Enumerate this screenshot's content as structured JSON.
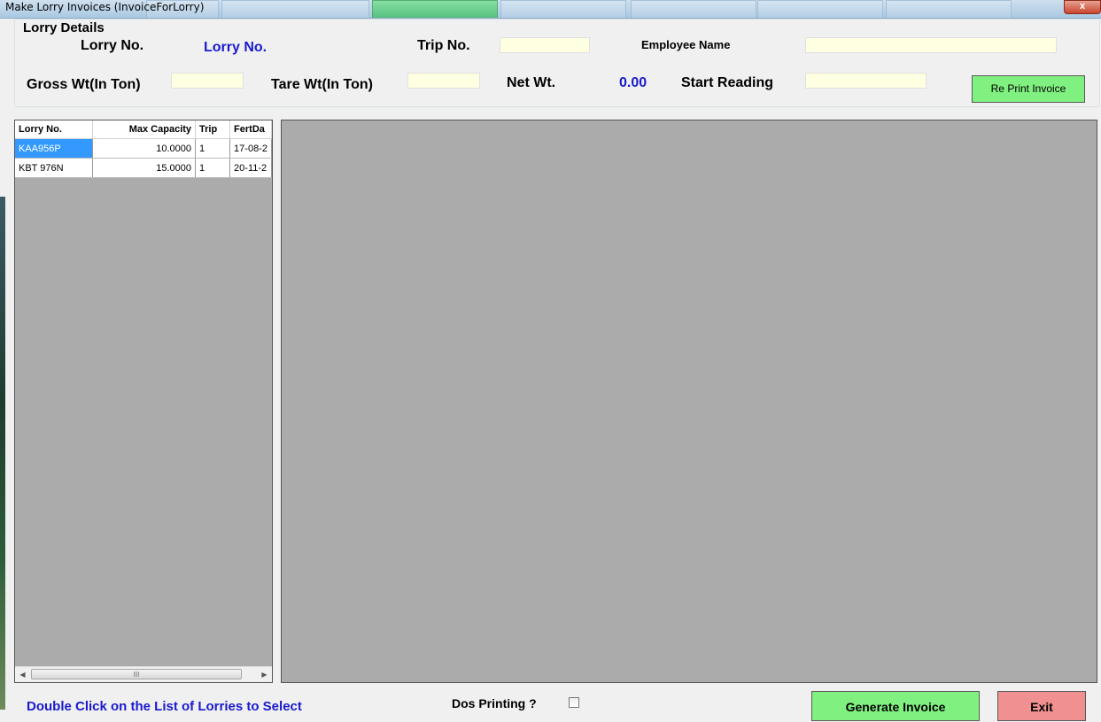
{
  "window": {
    "title": "Make Lorry Invoices (InvoiceForLorry)",
    "close_label": "x"
  },
  "colors": {
    "accent_blue": "#1a1ad0",
    "selection": "#3399ff",
    "green_button": "#80f080",
    "red_button": "#f09090",
    "input_fill": "#ffffe1"
  },
  "lorry_details": {
    "group_title": "Lorry Details",
    "lorry_no_label": "Lorry No.",
    "lorry_no_value": "Lorry No.",
    "trip_no_label": "Trip No.",
    "trip_no_value": "",
    "employee_name_label": "Employee Name",
    "employee_name_value": "",
    "gross_wt_label": "Gross Wt(In Ton)",
    "gross_wt_value": "",
    "tare_wt_label": "Tare Wt(In Ton)",
    "tare_wt_value": "",
    "net_wt_label": "Net Wt.",
    "net_wt_value": "0.00",
    "start_reading_label": "Start Reading",
    "start_reading_value": "",
    "reprint_button": "Re Print Invoice"
  },
  "grid": {
    "columns": [
      "Lorry No.",
      "Max Capacity",
      "Trip",
      "FertDa"
    ],
    "rows": [
      {
        "lorry_no": "KAA956P",
        "max_capacity": "10.0000",
        "trip": "1",
        "fert_date": "17-08-2"
      },
      {
        "lorry_no": "KBT 976N",
        "max_capacity": "15.0000",
        "trip": "1",
        "fert_date": "20-11-2"
      }
    ],
    "scroll_thumb_grip": "III"
  },
  "footer": {
    "hint": "Double Click on the List of Lorries to Select",
    "dos_printing_label": "Dos Printing ?",
    "generate_button": "Generate Invoice",
    "exit_button": "Exit"
  }
}
